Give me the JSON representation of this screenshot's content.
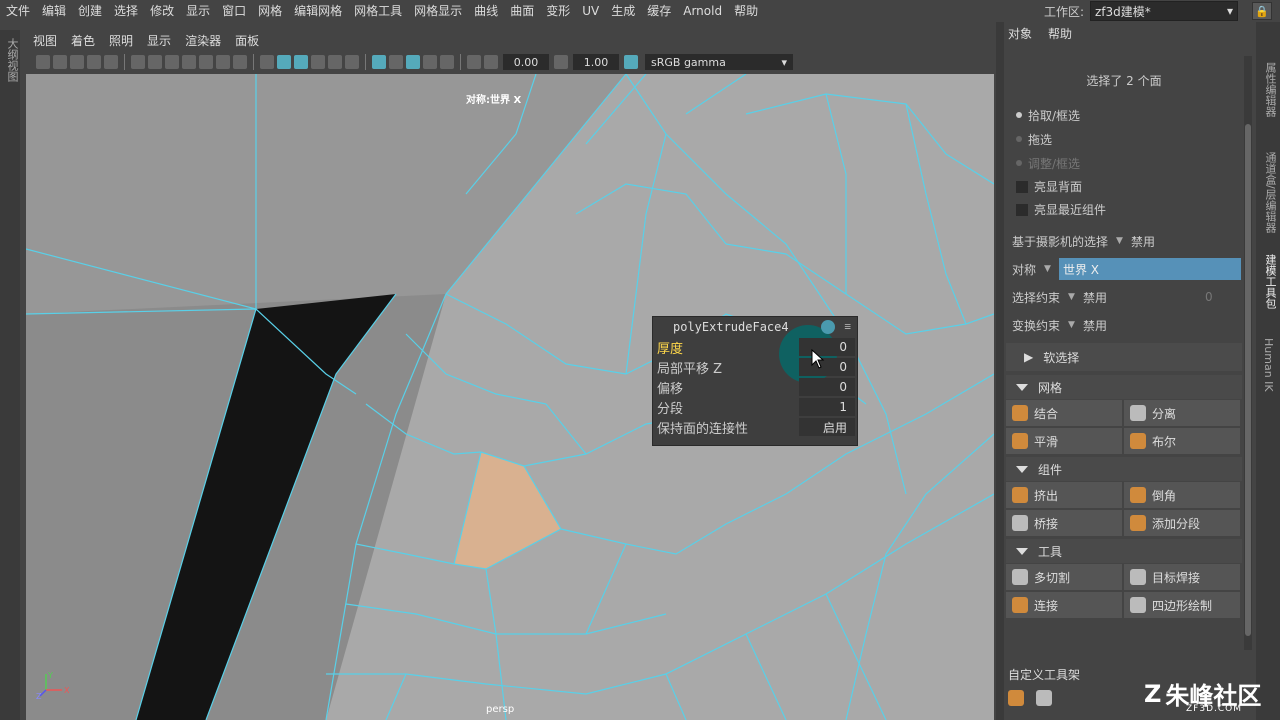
{
  "menubar": {
    "items": [
      "文件",
      "编辑",
      "创建",
      "选择",
      "修改",
      "显示",
      "窗口",
      "网格",
      "编辑网格",
      "网格工具",
      "网格显示",
      "曲线",
      "曲面",
      "变形",
      "UV",
      "生成",
      "缓存",
      "Arnold",
      "帮助"
    ],
    "workspace_label": "工作区:",
    "workspace_value": "zf3d建模*"
  },
  "left_strip": {
    "label": "大纲视图"
  },
  "viewport_menu": {
    "items": [
      "视图",
      "着色",
      "照明",
      "显示",
      "渲染器",
      "面板"
    ]
  },
  "viewport_toolbar": {
    "field1": "0.00",
    "field2": "1.00",
    "color_space": "sRGB gamma"
  },
  "viewport": {
    "symmetry_label": "对称:世界 X",
    "camera_label": "persp",
    "axis_labels": {
      "x": "X",
      "y": "Y",
      "z": "Z"
    }
  },
  "popup": {
    "title": "polyExtrudeFace4",
    "rows": [
      {
        "label": "厚度",
        "value": "0"
      },
      {
        "label": "局部平移 Z",
        "value": "0"
      },
      {
        "label": "偏移",
        "value": "0"
      },
      {
        "label": "分段",
        "value": "1"
      },
      {
        "label": "保持面的连接性",
        "value": "启用"
      }
    ]
  },
  "panel": {
    "menu": [
      "对象",
      "帮助"
    ],
    "selection_info": "选择了 2 个面",
    "radios": [
      "拾取/框选",
      "拖选",
      "调整/框选"
    ],
    "checks": [
      "亮显背面",
      "亮显最近组件"
    ],
    "camera_select_label": "基于摄影机的选择",
    "camera_select_value": "禁用",
    "symmetry_label": "对称",
    "symmetry_value": "世界 X",
    "sel_constraint_label": "选择约束",
    "sel_constraint_value": "禁用",
    "sel_constraint_num": "0",
    "xform_constraint_label": "变换约束",
    "xform_constraint_value": "禁用",
    "soft_select_label": "软选择",
    "sections": {
      "mesh": {
        "title": "网格",
        "buttons": [
          "结合",
          "分离",
          "平滑",
          "布尔"
        ]
      },
      "component": {
        "title": "组件",
        "buttons": [
          "挤出",
          "倒角",
          "桥接",
          "添加分段"
        ]
      },
      "tools": {
        "title": "工具",
        "buttons": [
          "多切割",
          "目标焊接",
          "连接",
          "四边形绘制"
        ]
      }
    },
    "shelf_label": "自定义工具架"
  },
  "right_tabs": [
    "属性编辑器",
    "通道盒/层编辑器",
    "建模工具包",
    "Human IK"
  ],
  "watermark": {
    "brand": "朱峰社区",
    "sub": "ZF3D.COM"
  }
}
